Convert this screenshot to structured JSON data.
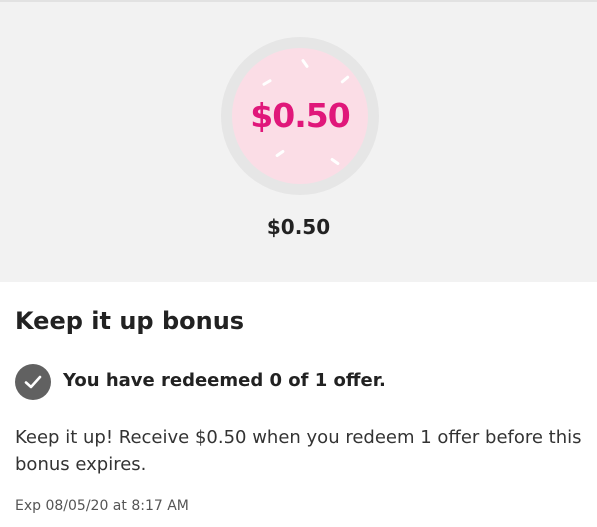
{
  "hero": {
    "badge_amount": "$0.50",
    "amount": "$0.50",
    "badge_color": "#e0177a",
    "badge_background": "#fbdde6"
  },
  "bonus": {
    "title": "Keep it up bonus",
    "status_icon": "check-circle-icon",
    "status_text": "You have redeemed 0 of 1 offer.",
    "description": "Keep it up! Receive $0.50 when you redeem 1 offer before this bonus expires.",
    "expiry": "Exp 08/05/20 at 8:17 AM"
  }
}
